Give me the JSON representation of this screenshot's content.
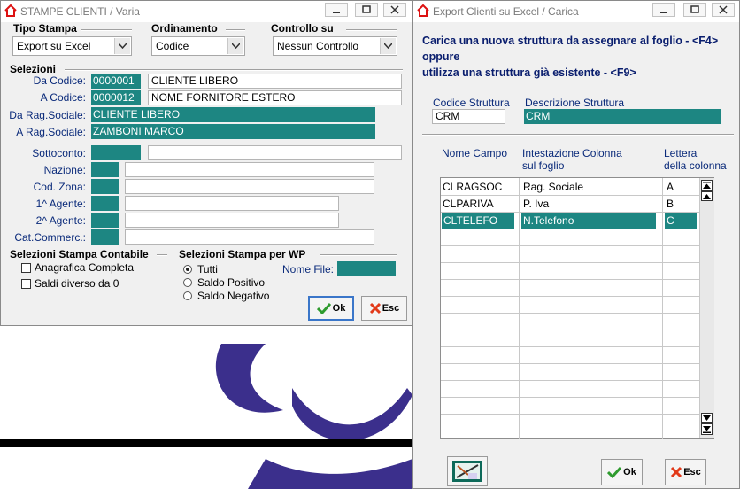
{
  "left_window": {
    "title": "STAMPE CLIENTI / Varia",
    "tipo_stampa": {
      "label": "Tipo Stampa",
      "value": "Export su Excel"
    },
    "ordinamento": {
      "label": "Ordinamento",
      "value": "Codice"
    },
    "controllo_su": {
      "label": "Controllo su",
      "value": "Nessun Controllo"
    },
    "selezioni_label": "Selezioni",
    "da_codice": {
      "label": "Da Codice:",
      "code": "0000001",
      "desc": "CLIENTE LIBERO"
    },
    "a_codice": {
      "label": "A  Codice:",
      "code": "0000012",
      "desc": "NOME FORNITORE ESTERO"
    },
    "da_rag": {
      "label": "Da Rag.Sociale:",
      "value": "CLIENTE LIBERO"
    },
    "a_rag": {
      "label": "A  Rag.Sociale:",
      "value": "ZAMBONI MARCO"
    },
    "sottoconto_label": "Sottoconto:",
    "nazione_label": "Nazione:",
    "cod_zona_label": "Cod. Zona:",
    "agente1_label": "1^ Agente:",
    "agente2_label": "2^ Agente:",
    "cat_commerc_label": "Cat.Commerc.:",
    "sel_contabile": {
      "label": "Selezioni Stampa Contabile",
      "opt1": "Anagrafica Completa",
      "opt2": "Saldi diverso da 0"
    },
    "sel_wp": {
      "label": "Selezioni Stampa per WP",
      "opt1": "Tutti",
      "opt2": "Saldo Positivo",
      "opt3": "Saldo Negativo",
      "nome_file_label": "Nome File:"
    },
    "ok_label": "Ok",
    "esc_label": "Esc"
  },
  "right_window": {
    "title": "Export Clienti su Excel / Carica",
    "instruction1": "Carica una nuova struttura da assegnare al foglio - <F4>",
    "instruction2": "oppure",
    "instruction3": "utilizza una struttura già esistente - <F9>",
    "codice_struttura_label": "Codice Struttura",
    "codice_struttura_value": "CRM",
    "descrizione_struttura_label": "Descrizione Struttura",
    "descrizione_struttura_value": "CRM",
    "col_nome": "Nome Campo",
    "col_intest1": "Intestazione Colonna",
    "col_intest2": "sul foglio",
    "col_lettera1": "Lettera",
    "col_lettera2": "della colonna",
    "rows": [
      {
        "nome": "CLRAGSOC",
        "intest": "Rag. Sociale",
        "lettera": "A"
      },
      {
        "nome": "CLPARIVA",
        "intest": "P. Iva",
        "lettera": "B"
      },
      {
        "nome": "CLTELEFO",
        "intest": "N.Telefono",
        "lettera": "C"
      }
    ],
    "ok_label": "Ok",
    "esc_label": "Esc"
  },
  "colors": {
    "teal": "#1d8682",
    "label_blue": "#0a2a7a",
    "title_gray": "#7a7a7a"
  }
}
